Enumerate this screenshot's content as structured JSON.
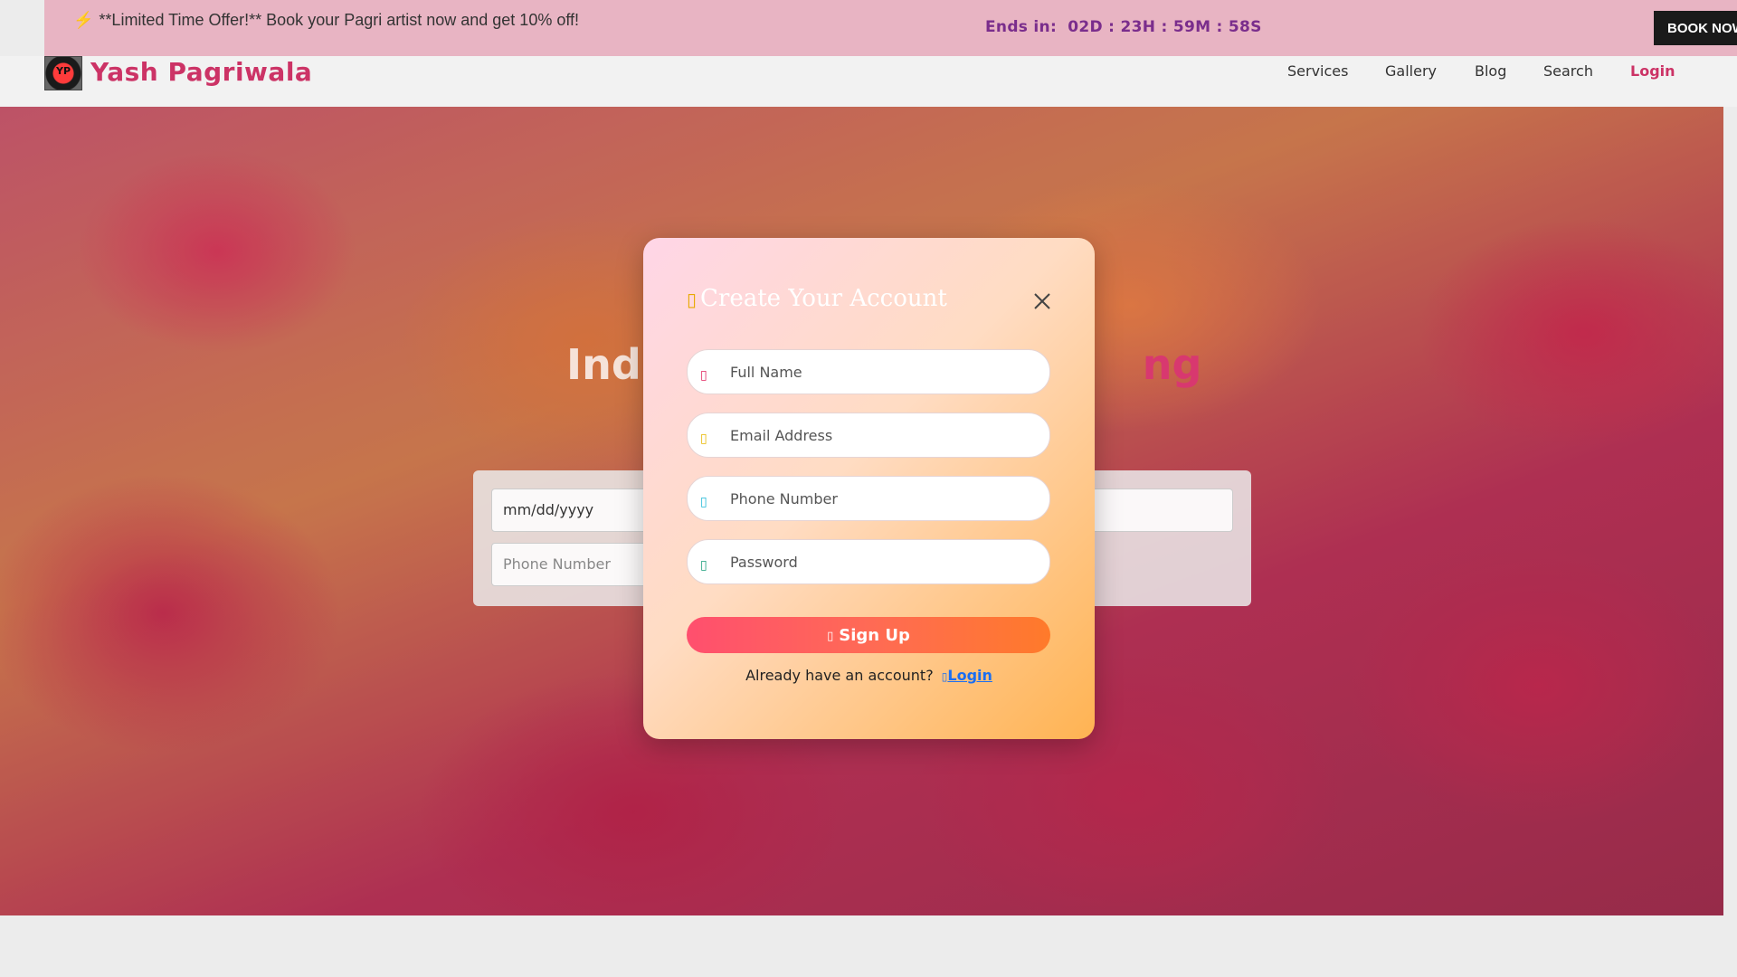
{
  "offer_bar": {
    "text": "**Limited Time Offer!** Book your Pagri artist now and get 10% off!",
    "countdown_label": "Ends in:",
    "days": "02D",
    "hours": "23H",
    "minutes": "59M",
    "seconds": "58S",
    "book_button": "BOOK NOW"
  },
  "navbar": {
    "logo_text": "YP",
    "brand": "Yash Pagriwala",
    "links": [
      "Services",
      "Gallery",
      "Blog",
      "Search",
      "Login"
    ]
  },
  "hero": {
    "title_start": "Ind",
    "title_end": "ng",
    "form": {
      "date_placeholder": "mm/dd/yyyy",
      "phone_placeholder": "Phone Number"
    }
  },
  "modal": {
    "title": "Create Your Account",
    "fields": {
      "full_name": "Full Name",
      "email": "Email Address",
      "phone": "Phone Number",
      "password": "Password"
    },
    "signup_button": "Sign Up",
    "already_text": "Already have an account?",
    "login_link": "Login"
  },
  "colors": {
    "brand": "#cc3366",
    "offer_bar": "#e8b4c3",
    "countdown": "#7a2d8c",
    "link": "#1a6ef2"
  }
}
